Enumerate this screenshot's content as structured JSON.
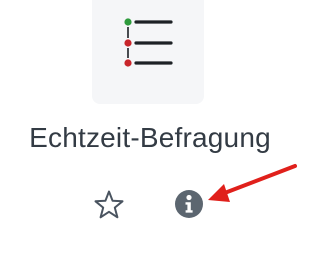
{
  "module": {
    "title": "Echtzeit-Befragung",
    "icon": "list-icon"
  },
  "actions": {
    "star": {
      "icon": "star-icon",
      "state": "unstarred"
    },
    "info": {
      "icon": "info-icon"
    }
  },
  "annotation": {
    "icon": "red-arrow-icon",
    "color": "#e0201b"
  },
  "colors": {
    "tile_background": "#f5f6f8",
    "text": "#333b44",
    "icon_dark": "#1d2125",
    "bullet_green": "#2e9b3d",
    "bullet_red": "#c8262b",
    "info_icon": "#5c6670"
  }
}
